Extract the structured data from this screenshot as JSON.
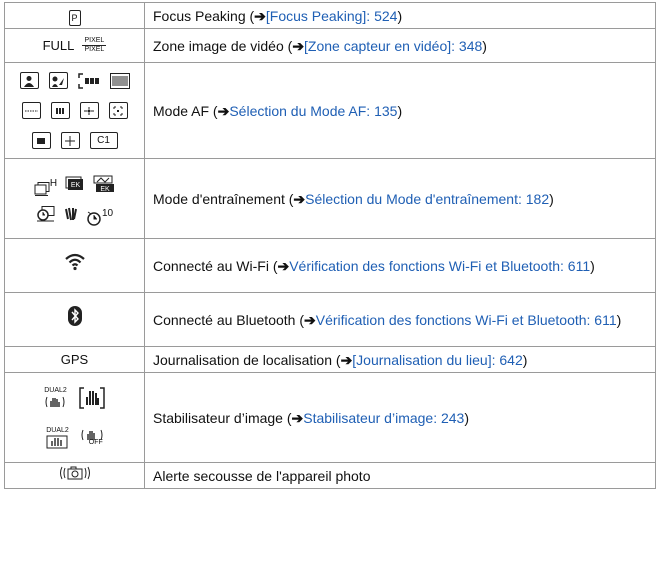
{
  "rows": [
    {
      "icons": {
        "p": "P"
      },
      "text": "Focus Peaking (",
      "link": "[Focus Peaking]: 524",
      "tail": ")"
    },
    {
      "icons": {
        "full": "FULL",
        "pixel": "PIXEL"
      },
      "text": "Zone image de vidéo (",
      "link": "[Zone capteur en vidéo]: 348",
      "tail": ")"
    },
    {
      "icons": {
        "c1": "C1"
      },
      "text": "Mode AF (",
      "link": "Sélection du Mode AF: 135",
      "tail": ")"
    },
    {
      "icons": {
        "h": "H",
        "ek": "EK",
        "ten": "10"
      },
      "text": "Mode d'entraînement (",
      "link": "Sélection du Mode d'entraînement: 182",
      "tail": ")"
    },
    {
      "icons": {},
      "text": "Connecté au Wi-Fi (",
      "link": "Vérification des fonctions Wi-Fi et Bluetooth: 611",
      "tail": ")"
    },
    {
      "icons": {},
      "text": "Connecté au Bluetooth (",
      "link": "Vérification des fonctions Wi-Fi et Bluetooth: 611",
      "tail": ")"
    },
    {
      "icons": {
        "gps": "GPS"
      },
      "text": "Journalisation de localisation (",
      "link": "[Journalisation du lieu]: 642",
      "tail": ")"
    },
    {
      "icons": {
        "dual": "DUAL2",
        "off": "OFF"
      },
      "text": "Stabilisateur d’image (",
      "link": "Stabilisateur d’image: 243",
      "tail": ")"
    },
    {
      "icons": {},
      "text": "Alerte secousse de l'appareil photo",
      "link": "",
      "tail": ""
    }
  ],
  "arrow": "➔"
}
